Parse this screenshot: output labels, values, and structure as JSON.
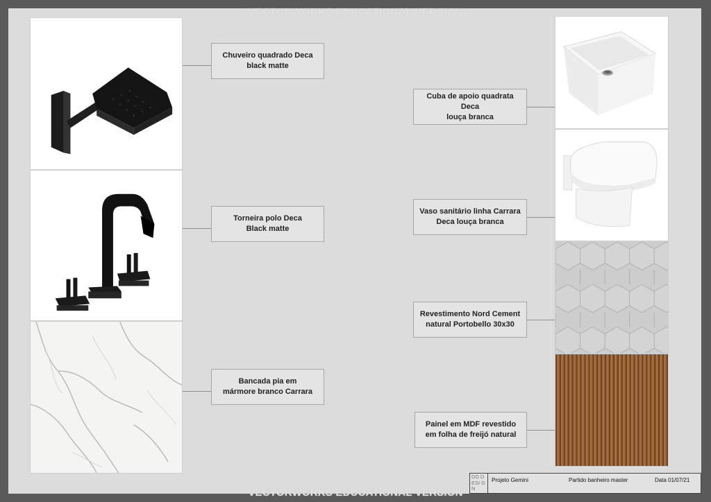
{
  "watermark": "VECTORWORKS EDUCATIONAL VERSION",
  "items_left": [
    {
      "line1": "Chuveiro quadrado Deca",
      "line2": "black matte"
    },
    {
      "line1": "Torneira polo Deca",
      "line2": "Black matte"
    },
    {
      "line1": "Bancada pia em",
      "line2": "mármore branco Carrara"
    }
  ],
  "items_right": [
    {
      "line1": "Cuba de apoio quadrata Deca",
      "line2": "louça branca"
    },
    {
      "line1": "Vaso sanitário linha Carrara",
      "line2": "Deca louça branca"
    },
    {
      "line1": "Revestimento Nord Cement",
      "line2": "natural Portobello 30x30"
    },
    {
      "line1": "Painel em MDF revestido",
      "line2": "em folha de freijó natural"
    }
  ],
  "title_block": {
    "logo": "DD DESI GN",
    "project": "Projeto Gemini",
    "sheet": "Partido banheiro master",
    "date": "Data 01/07/21"
  }
}
